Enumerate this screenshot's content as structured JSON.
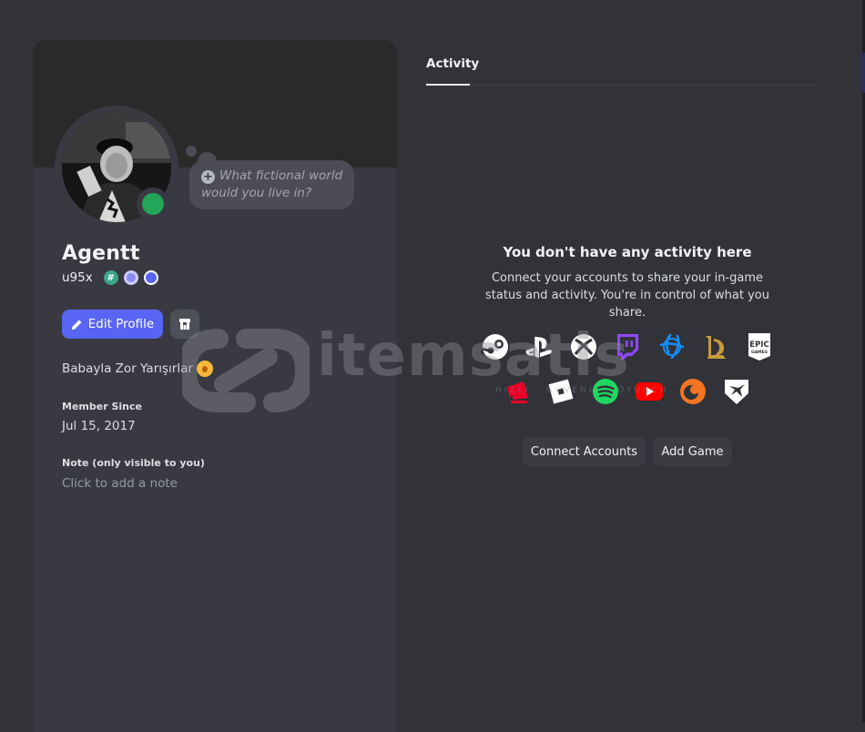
{
  "profile": {
    "bubble_text": "What fictional world would you live in?",
    "display_name": "Agentt",
    "username": "u95x",
    "edit_profile_label": "Edit Profile",
    "custom_status": "Babayla Zor Yarışırlar",
    "member_since_label": "Member Since",
    "member_since_value": "Jul 15, 2017",
    "note_label": "Note (only visible to you)",
    "note_placeholder": "Click to add a note",
    "status": "online",
    "colors": {
      "status": "#23a55a",
      "accent": "#5865f2"
    }
  },
  "activity": {
    "tab_label": "Activity",
    "empty_title": "You don't have any activity here",
    "empty_desc": "Connect your accounts to share your in-game status and activity. You're in control of what you share.",
    "platforms": [
      "steam-icon",
      "playstation-icon",
      "xbox-icon",
      "twitch-icon",
      "battlenet-icon",
      "league-of-legends-icon",
      "epic-games-icon",
      "riot-games-icon",
      "roblox-icon",
      "spotify-icon",
      "youtube-icon",
      "crunchyroll-icon",
      "bungie-icon"
    ],
    "epic_label": "EPIC",
    "epic_sub": "GAMES",
    "connect_label": "Connect Accounts",
    "add_game_label": "Add Game"
  },
  "watermark": {
    "text": "itemsatis",
    "subtext": "HIZLI · GÜVENLİ · OYUNCU"
  }
}
